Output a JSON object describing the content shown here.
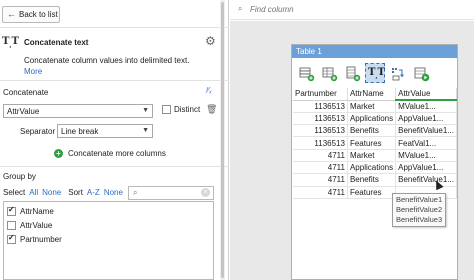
{
  "left_panel": {
    "back_label": "Back to list",
    "title": "Concatenate text",
    "description": "Concatenate column values into delimited text.",
    "more_link": "More",
    "concatenate_label": "Concatenate",
    "concatenate_value": "AttrValue",
    "distinct_label": "Distinct",
    "separator_label": "Separator",
    "separator_value": "Line break",
    "concat_more_label": "Concatenate more columns",
    "group_by_label": "Group by",
    "select_label": "Select",
    "select_all": "All",
    "select_none": "None",
    "sort_label": "Sort",
    "sort_az": "A-Z",
    "sort_none": "None",
    "group_items": [
      {
        "label": "AttrName",
        "checked": true
      },
      {
        "label": "AttrValue",
        "checked": false
      },
      {
        "label": "Partnumber",
        "checked": true
      }
    ]
  },
  "findbar": {
    "placeholder": "Find column"
  },
  "table_window": {
    "title": "Table 1",
    "columns": [
      "Partnumber",
      "AttrName",
      "AttrValue"
    ],
    "rows": [
      [
        "1136513",
        "Market",
        "MValue1..."
      ],
      [
        "1136513",
        "Applications",
        "AppValue1..."
      ],
      [
        "1136513",
        "Benefits",
        "BenefitValue1..."
      ],
      [
        "1136513",
        "Features",
        "FeatVal1..."
      ],
      [
        "4711",
        "Market",
        "MValue1..."
      ],
      [
        "4711",
        "Applications",
        "AppValue1..."
      ],
      [
        "4711",
        "Benefits",
        "BenefitValue1..."
      ],
      [
        "4711",
        "Features",
        ""
      ]
    ],
    "tooltip_lines": [
      "BenefitValue1",
      "BenefitValue2",
      "BenefitValue3"
    ]
  },
  "colors": {
    "accent_blue": "#6b9fd8",
    "link_blue": "#2b6cc4",
    "green": "#2e9e3e"
  }
}
